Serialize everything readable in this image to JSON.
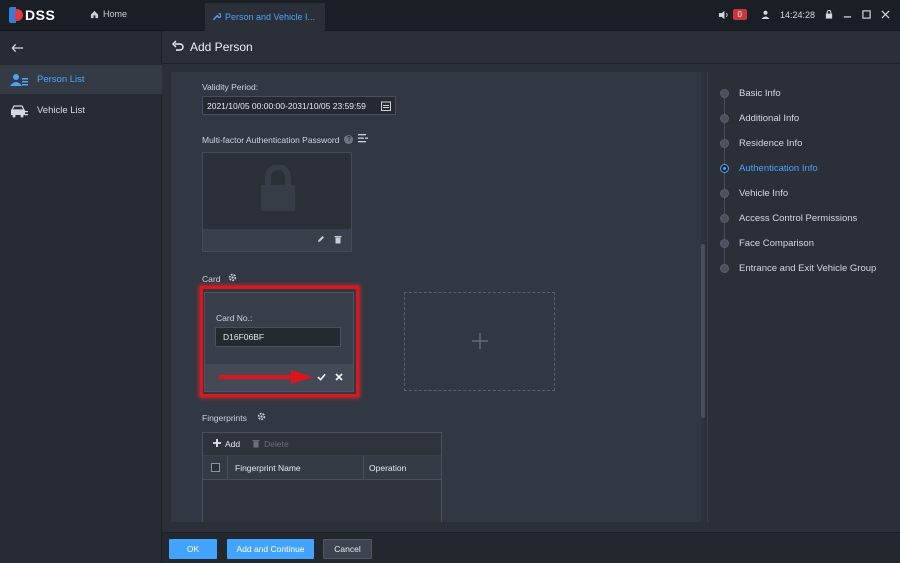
{
  "app": {
    "logo_text": "DSS"
  },
  "tabs": {
    "home": "Home",
    "active": "Person and Vehicle I..."
  },
  "topbar": {
    "alarm_count": "0",
    "time": "14:24:28"
  },
  "sidebar": {
    "items": [
      {
        "label": "Person List",
        "active": true
      },
      {
        "label": "Vehicle List",
        "active": false
      }
    ]
  },
  "header": {
    "title": "Add Person"
  },
  "form": {
    "validity_label": "Validity Period:",
    "validity_value": "2021/10/05 00:00:00-2031/10/05 23:59:59",
    "mfa_label": "Multi-factor Authentication Password",
    "card_label": "Card",
    "card_no_label": "Card No.:",
    "card_no_value": "D16F06BF",
    "fingerprints_label": "Fingerprints",
    "fp_add": "Add",
    "fp_delete": "Delete",
    "fp_col_name": "Fingerprint Name",
    "fp_col_operation": "Operation"
  },
  "rightnav": {
    "items": [
      {
        "label": "Basic Info",
        "active": false
      },
      {
        "label": "Additional Info",
        "active": false
      },
      {
        "label": "Residence Info",
        "active": false
      },
      {
        "label": "Authentication Info",
        "active": true
      },
      {
        "label": "Vehicle Info",
        "active": false
      },
      {
        "label": "Access Control Permissions",
        "active": false
      },
      {
        "label": "Face Comparison",
        "active": false
      },
      {
        "label": "Entrance and Exit Vehicle Group",
        "active": false
      }
    ]
  },
  "footer": {
    "ok": "OK",
    "add_continue": "Add and Continue",
    "cancel": "Cancel"
  },
  "colors": {
    "accent": "#43a4ff",
    "highlight_frame": "#e0151b",
    "alarm": "#c9373c"
  }
}
